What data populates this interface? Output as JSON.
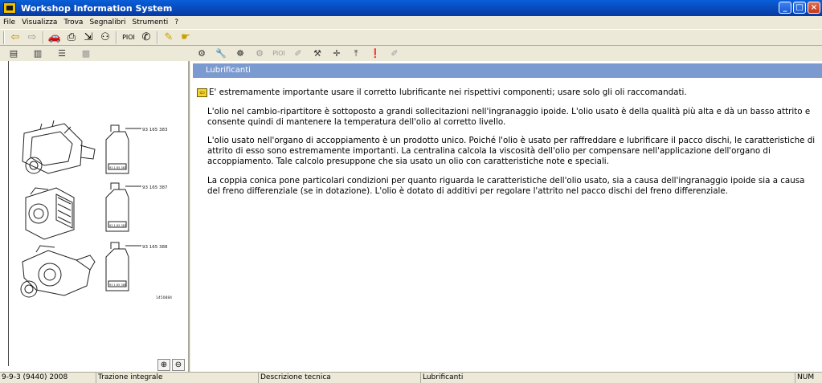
{
  "window": {
    "title": "Workshop Information System",
    "controls": {
      "minimize": "_",
      "maximize": "□",
      "close": "×"
    }
  },
  "menubar": {
    "items": [
      "File",
      "Visualizza",
      "Trova",
      "Segnalibri",
      "Strumenti",
      "?"
    ]
  },
  "toolbar": {
    "piui_label": "PIOI",
    "icons": [
      "back-arrow-icon",
      "forward-arrow-icon",
      "car-icon",
      "print-icon",
      "export-icon",
      "binoculars-icon",
      "vin-icon",
      "marker-icon",
      "note-icon"
    ]
  },
  "tabs": {
    "left": [
      "table-of-contents-icon",
      "bookmark-icon",
      "list-icon",
      "image-icon"
    ],
    "right_piui_label": "PIOI"
  },
  "illustration": {
    "part_numbers": [
      "93 165 383",
      "93 165 387",
      "93 165 388"
    ],
    "bottle_labels": [
      "93 1 65 383",
      "93 1 65 387",
      "93 1 65 388"
    ],
    "figure_code": "1450884"
  },
  "section": {
    "title": "Lubrificanti"
  },
  "content": {
    "intro": "E' estremamente importante usare il corretto lubrificante nei rispettivi componenti; usare solo gli oli raccomandati.",
    "paragraphs": [
      "L'olio nel cambio-ripartitore è sottoposto a grandi sollecitazioni nell'ingranaggio ipoide. L'olio usato è della qualità più alta e dà un basso attrito e consente quindi di mantenere la temperatura dell'olio al corretto livello.",
      "L'olio usato nell'organo di accoppiamento è un prodotto unico. Poiché l'olio è usato per raffreddare e lubrificare il pacco dischi, le caratteristiche di attrito di esso sono estremamente importanti. La centralina calcola la viscosità dell'olio per compensare nell'applicazione dell'organo di accoppiamento. Tale calcolo presuppone che sia usato un olio con caratteristiche note e speciali.",
      "La coppia conica pone particolari condizioni per quanto riguarda le caratteristiche dell'olio usato, sia a causa dell'ingranaggio ipoide sia a causa del freno differenziale (se in dotazione). L'olio è dotato di additivi per regolare l'attrito nel pacco dischi del freno differenziale."
    ]
  },
  "statusbar": {
    "vehicle": "9-3 (9440) 2008",
    "vehicle_prefix": "9-",
    "system": "Trazione integrale",
    "doc_type": "Descrizione tecnica",
    "topic": "Lubrificanti",
    "numlock": "NUM"
  },
  "colors": {
    "titlebar": "#0a5fd8",
    "section_header": "#7b9bd0",
    "chrome": "#ece9d8"
  }
}
